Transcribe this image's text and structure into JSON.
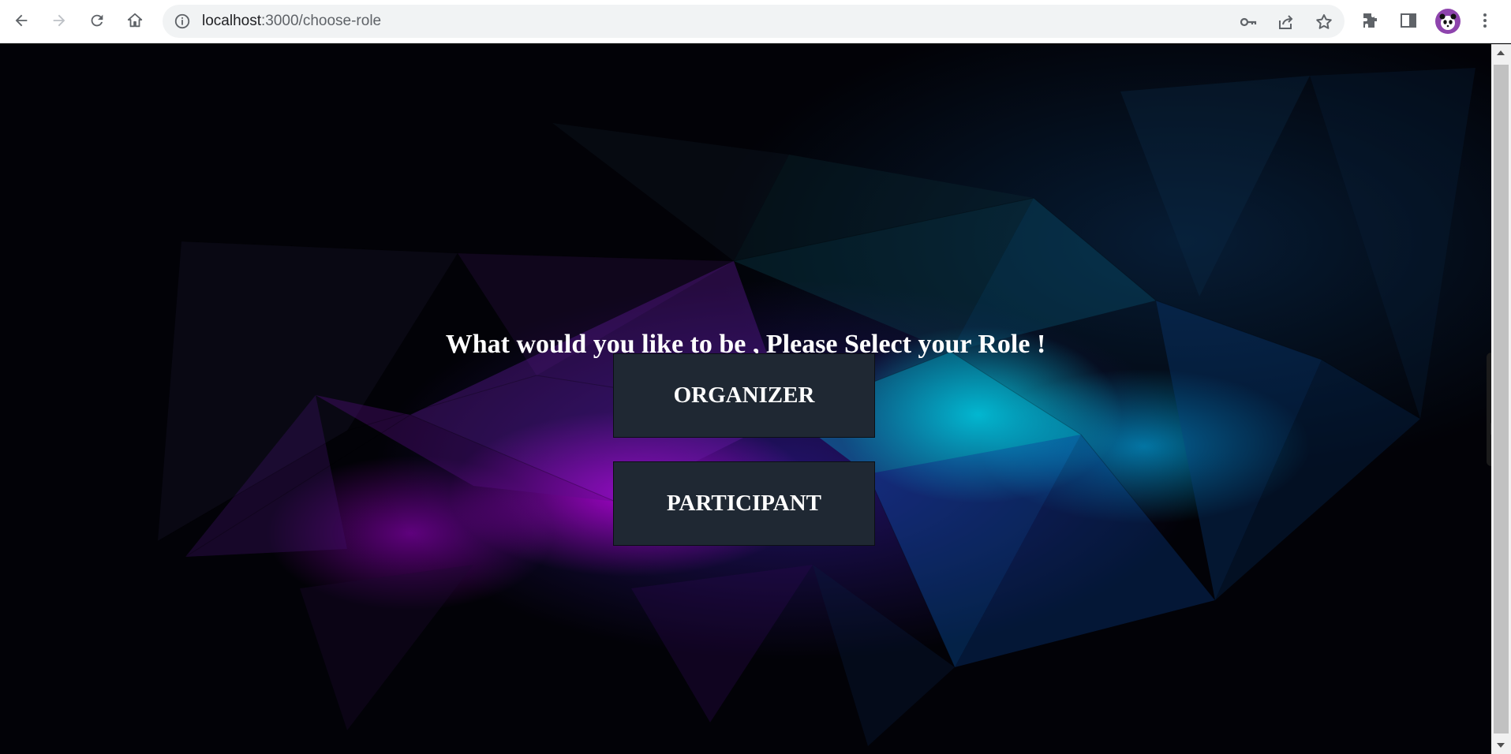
{
  "browser": {
    "url_host": "localhost",
    "url_path": ":3000/choose-role"
  },
  "page": {
    "heading": "What would you like to be , Please Select your Role !",
    "roles": [
      {
        "label": "ORGANIZER"
      },
      {
        "label": "PARTICIPANT"
      }
    ]
  },
  "colors": {
    "button_bg": "#1f2833",
    "heading_text": "#ffffff",
    "avatar_bg": "#8e44ad"
  },
  "icons": {
    "side_tools": [
      "camera-icon",
      "video-icon",
      "gallery-icon",
      "settings-icon"
    ]
  }
}
